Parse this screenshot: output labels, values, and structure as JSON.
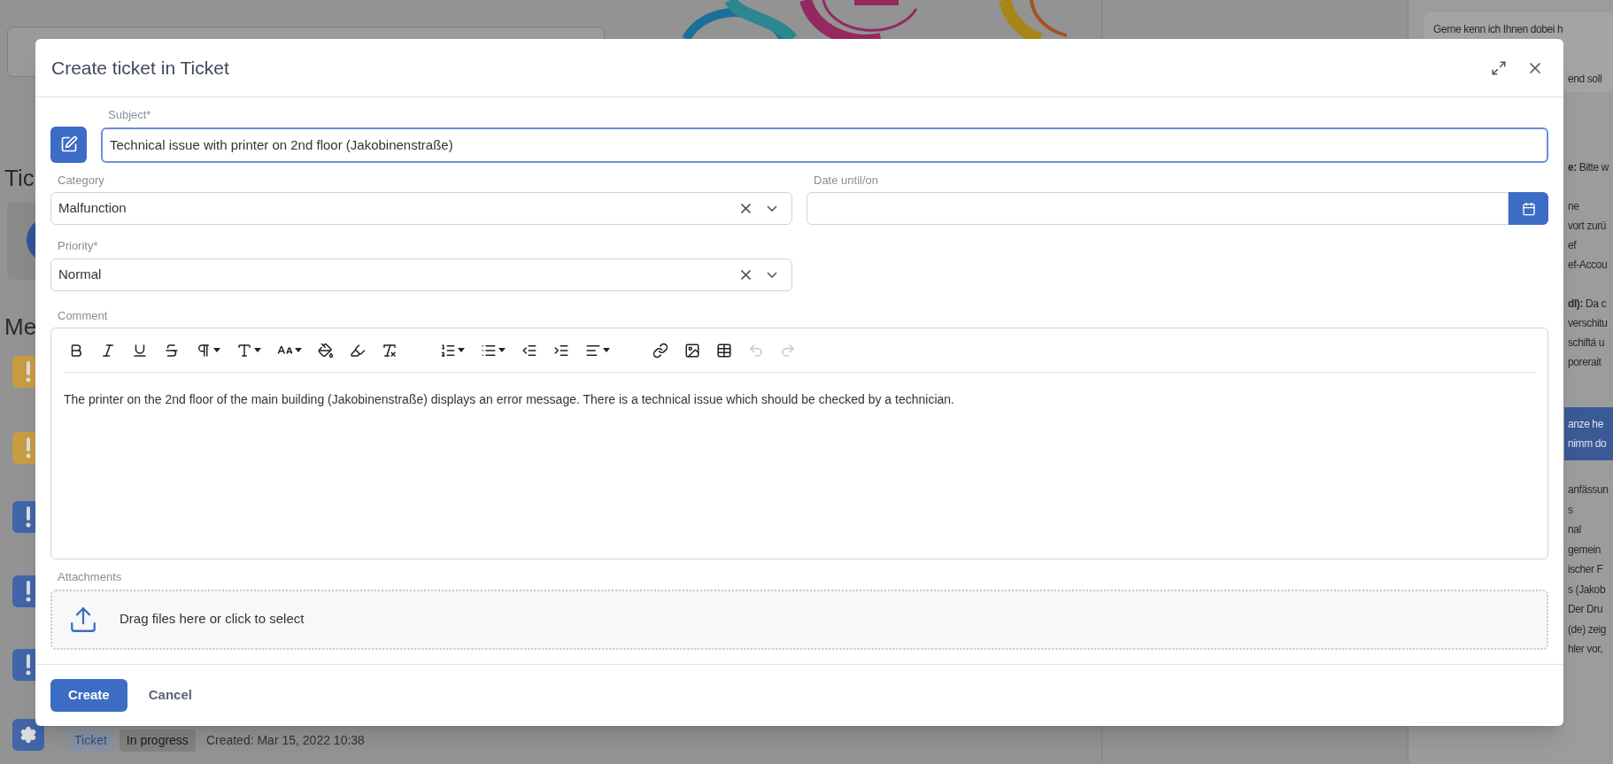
{
  "background": {
    "left_headings": [
      "Tic",
      "Me"
    ],
    "messages": [
      {
        "kind": "alert",
        "color": "#c89c42"
      },
      {
        "kind": "alert",
        "color": "#c89c42"
      },
      {
        "kind": "alert",
        "color": "#4165a8"
      },
      {
        "kind": "alert",
        "color": "#4165a8"
      },
      {
        "kind": "alert",
        "color": "#4165a8"
      },
      {
        "kind": "settings",
        "color": "#4165a8"
      }
    ],
    "last_message": {
      "tags": [
        "Ticket",
        "In progress"
      ],
      "created": "Created: Mar 15, 2022 10:38"
    },
    "right_panel": {
      "first_line": "Gerne kenn ich Ihnen dobei h",
      "blocks": [
        [
          "end soll"
        ],
        [
          "**e:** Bitte w"
        ],
        [
          "ne",
          "vort zurü",
          "ef",
          "ef-Accou"
        ],
        [
          "**dl):** Da c",
          "verschitu",
          "schiftá u",
          "porerait"
        ]
      ],
      "banner": [
        "anze he",
        "nimm do"
      ],
      "lines_after": [
        "anfässun",
        "s",
        "nal",
        "gemein",
        "ischer F",
        "s (Jakob",
        "Der Dru",
        "(de) zeig",
        "hler vor,"
      ]
    }
  },
  "dialog": {
    "title": "Create ticket in Ticket",
    "subject": {
      "label": "Subject*",
      "value": "Technical issue with printer on 2nd floor (Jakobinenstraße)",
      "focused": true
    },
    "category": {
      "label": "Category",
      "value": "Malfunction"
    },
    "date": {
      "label": "Date until/on"
    },
    "priority": {
      "label": "Priority*",
      "value": "Normal"
    },
    "comment": {
      "label": "Comment",
      "text": "The printer on the 2nd floor of the main building (Jakobinenstraße) displays an error message. There is a technical issue which should be checked by a technician.",
      "toolbar": [
        [
          {
            "kind": "bold",
            "disabled": false
          },
          {
            "kind": "italic",
            "disabled": false
          },
          {
            "kind": "underline",
            "disabled": false
          },
          {
            "kind": "strike",
            "disabled": false
          },
          {
            "kind": "paragraph",
            "disabled": false
          },
          {
            "kind": "font",
            "disabled": false
          },
          {
            "kind": "size",
            "disabled": false
          },
          {
            "kind": "color",
            "disabled": false
          },
          {
            "kind": "highlight",
            "disabled": false
          },
          {
            "kind": "clear",
            "disabled": false
          }
        ],
        [
          {
            "kind": "ordered",
            "disabled": false
          },
          {
            "kind": "bullets",
            "disabled": false
          },
          {
            "kind": "outdent",
            "disabled": false
          },
          {
            "kind": "indent",
            "disabled": false
          },
          {
            "kind": "align",
            "disabled": false
          }
        ],
        [
          {
            "kind": "link",
            "disabled": false
          },
          {
            "kind": "image",
            "disabled": false
          },
          {
            "kind": "table",
            "disabled": false
          },
          {
            "kind": "undo",
            "disabled": true
          },
          {
            "kind": "redo",
            "disabled": true
          }
        ]
      ]
    },
    "attachments": {
      "label": "Attachments",
      "hint": "Drag files here or click to select"
    },
    "buttons": [
      {
        "kind": "primary",
        "label": "Create"
      },
      {
        "kind": "link",
        "label": "Cancel"
      }
    ]
  }
}
